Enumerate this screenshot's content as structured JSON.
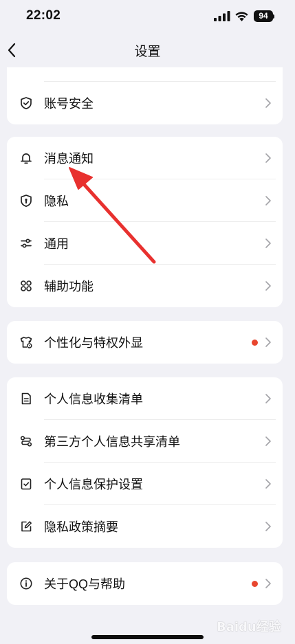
{
  "status_bar": {
    "time": "22:02",
    "battery": "94"
  },
  "header": {
    "title": "设置"
  },
  "groups": [
    {
      "items": [
        {
          "label": "账号安全",
          "icon": "shield-check-icon"
        }
      ]
    },
    {
      "items": [
        {
          "label": "消息通知",
          "icon": "bell-icon"
        },
        {
          "label": "隐私",
          "icon": "privacy-shield-icon"
        },
        {
          "label": "通用",
          "icon": "sliders-icon"
        },
        {
          "label": "辅助功能",
          "icon": "grid-icon"
        }
      ]
    },
    {
      "items": [
        {
          "label": "个性化与特权外显",
          "icon": "tshirt-icon",
          "badge": true
        }
      ]
    },
    {
      "items": [
        {
          "label": "个人信息收集清单",
          "icon": "document-icon"
        },
        {
          "label": "第三方个人信息共享清单",
          "icon": "share-list-icon"
        },
        {
          "label": "个人信息保护设置",
          "icon": "check-box-icon"
        },
        {
          "label": "隐私政策摘要",
          "icon": "edit-icon"
        }
      ]
    },
    {
      "items": [
        {
          "label": "关于QQ与帮助",
          "icon": "info-icon",
          "badge": true
        }
      ]
    }
  ],
  "watermark": "Baidu经验",
  "colors": {
    "badge": "#e8462f",
    "annotation_arrow": "#e8312f",
    "background": "#f1f1f6"
  }
}
